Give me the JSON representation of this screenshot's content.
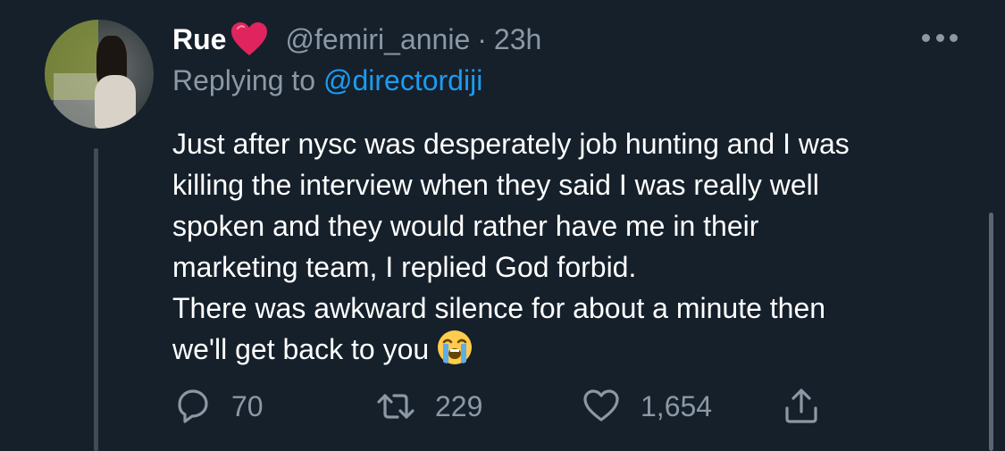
{
  "tweet": {
    "display_name": "Rue",
    "handle": "@femiri_annie",
    "separator": "·",
    "timestamp": "23h",
    "replying_prefix": "Replying to",
    "replying_to": "@directordiji",
    "body_lines": [
      "Just after nysc was desperately job hunting and I was",
      "killing the interview when they said I was really well",
      "spoken and they would rather have me in their",
      "marketing team, I replied God forbid.",
      "There was awkward silence for about a minute then",
      "we'll get back to you"
    ]
  },
  "actions": {
    "replies": "70",
    "retweets": "229",
    "likes": "1,654"
  },
  "icons": {
    "name_emoji": "red-heart-icon",
    "body_emoji": "loudly-crying-face-icon",
    "reply": "reply-icon",
    "retweet": "retweet-icon",
    "like": "like-icon",
    "share": "share-icon",
    "more": "more-icon"
  },
  "colors": {
    "background": "#15202b",
    "text": "#ffffff",
    "muted": "#8b98a5",
    "link": "#1d9bf0",
    "heart": "#e0245e"
  }
}
